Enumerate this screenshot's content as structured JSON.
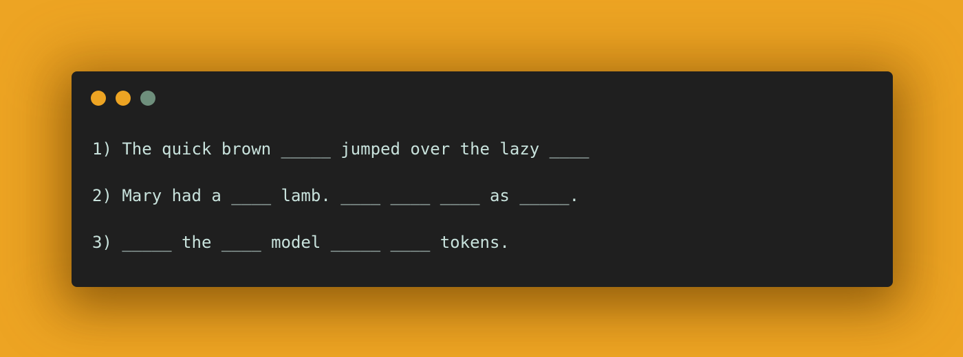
{
  "window": {
    "controls": [
      {
        "name": "close",
        "color": "#eda423"
      },
      {
        "name": "minimize",
        "color": "#eda423"
      },
      {
        "name": "maximize",
        "color": "#6e8f7c"
      }
    ],
    "lines": [
      "1) The quick brown _____ jumped over the lazy ____",
      "2) Mary had a ____ lamb. ____ ____ ____ as _____.",
      "3) _____ the ____ model _____ ____ tokens."
    ]
  },
  "colors": {
    "background": "#eda423",
    "window": "#1f1f1f",
    "text": "#c8e2dc"
  }
}
